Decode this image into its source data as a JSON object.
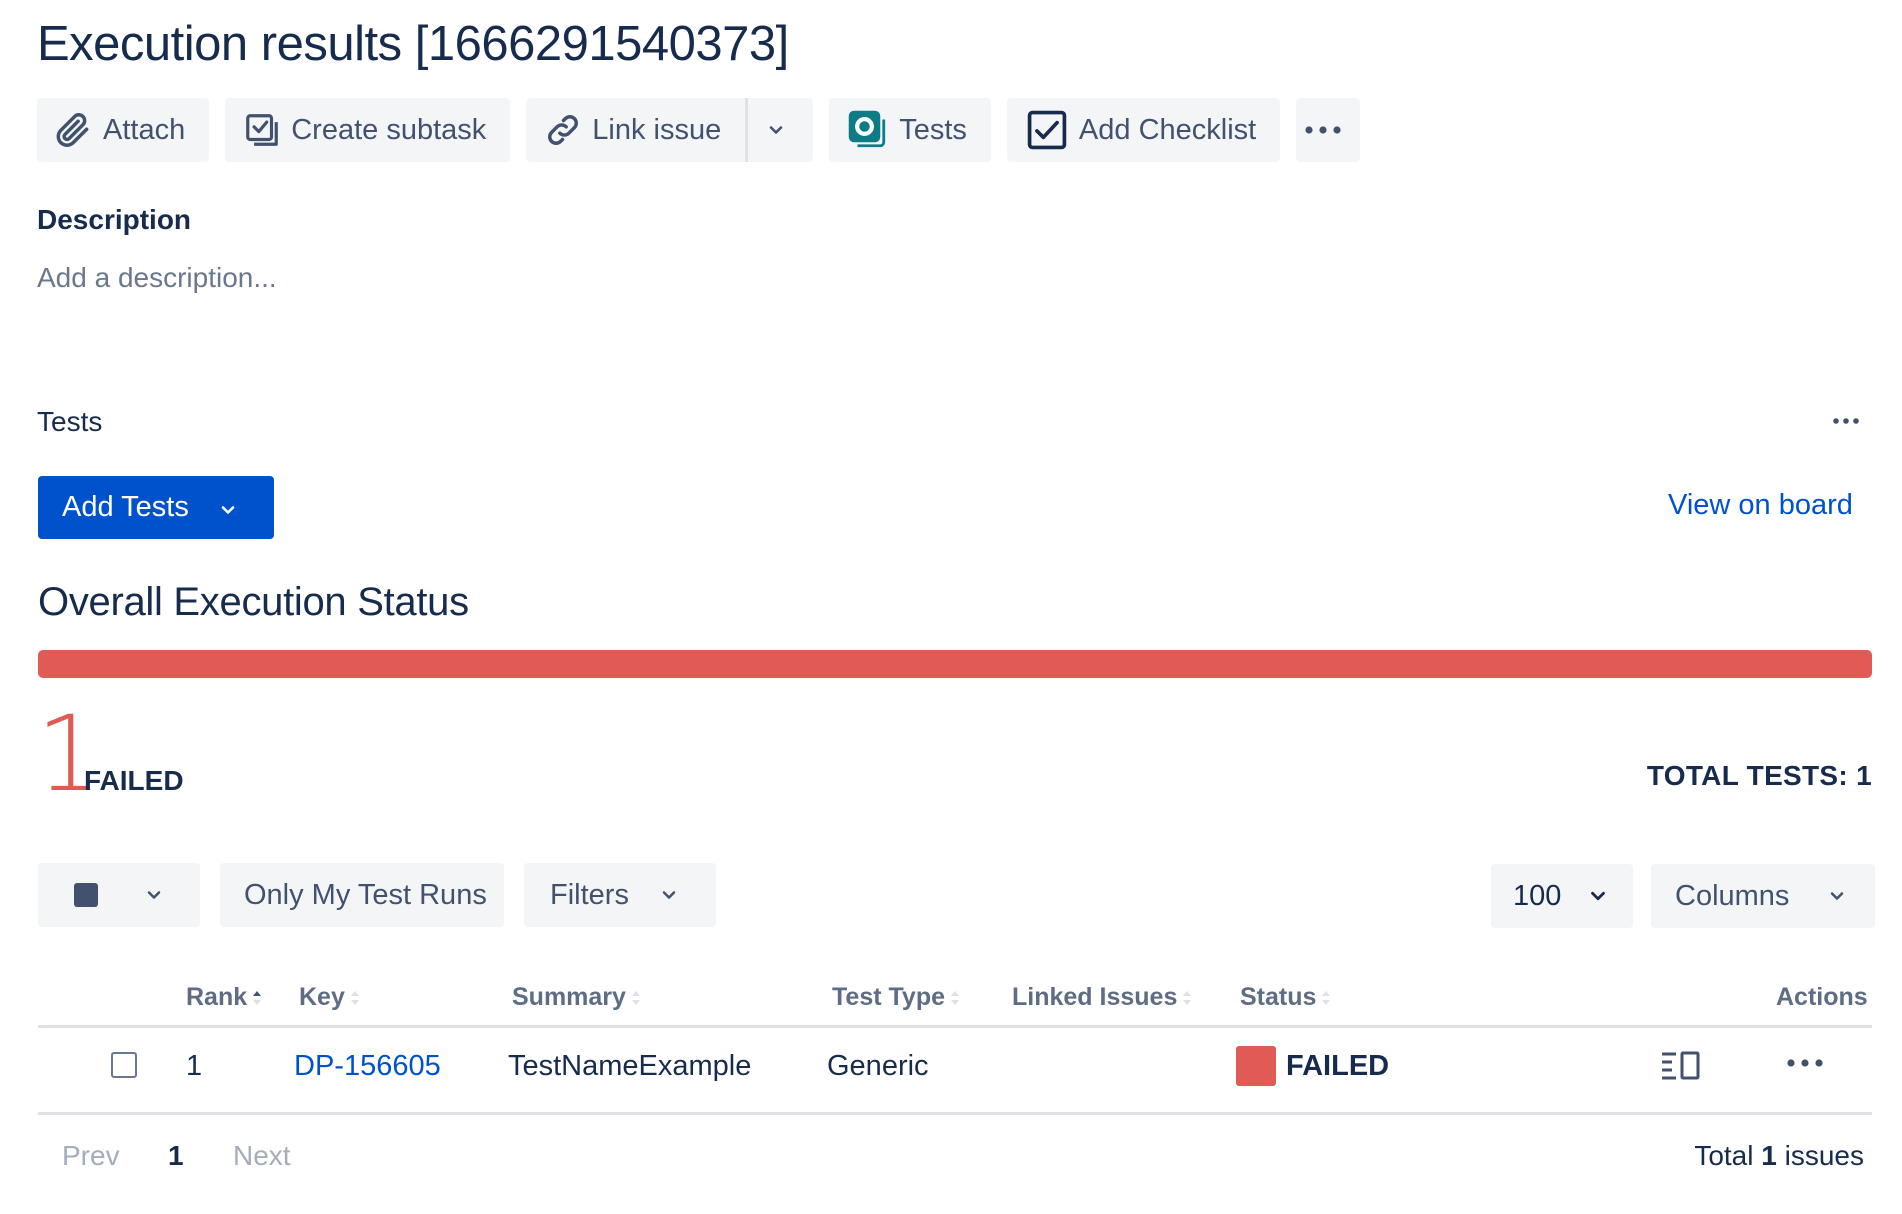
{
  "title": "Execution results [1666291540373]",
  "toolbar": {
    "attach": "Attach",
    "create_subtask": "Create subtask",
    "link_issue": "Link issue",
    "tests": "Tests",
    "add_checklist": "Add Checklist"
  },
  "description": {
    "label": "Description",
    "placeholder": "Add a description..."
  },
  "tests_panel": {
    "label": "Tests",
    "add_tests": "Add Tests",
    "view_on_board": "View on board",
    "overall_title": "Overall Execution Status",
    "progress_failed_fraction": 1.0,
    "failed_count": "1",
    "failed_label": "FAILED",
    "total_tests": "TOTAL TESTS: 1",
    "colors": {
      "failed": "#E05B56",
      "primary": "#0052CC"
    }
  },
  "controls": {
    "only_my_runs": "Only My Test Runs",
    "filters": "Filters",
    "page_size": "100",
    "columns": "Columns"
  },
  "table": {
    "headers": {
      "rank": "Rank",
      "key": "Key",
      "summary": "Summary",
      "test_type": "Test Type",
      "linked_issues": "Linked Issues",
      "status": "Status",
      "actions": "Actions"
    },
    "rows": [
      {
        "rank": "1",
        "key": "DP-156605",
        "summary": "TestNameExample",
        "test_type": "Generic",
        "linked_issues": "",
        "status": "FAILED"
      }
    ]
  },
  "pagination": {
    "prev": "Prev",
    "current": "1",
    "next": "Next",
    "total_prefix": "Total",
    "total_count": "1",
    "total_suffix": "issues"
  },
  "icons": [
    "paperclip-icon",
    "subtask-icon",
    "link-icon",
    "chevron-down-icon",
    "tests-app-icon",
    "checklist-icon",
    "more-icon",
    "sort-icon",
    "details-icon"
  ]
}
